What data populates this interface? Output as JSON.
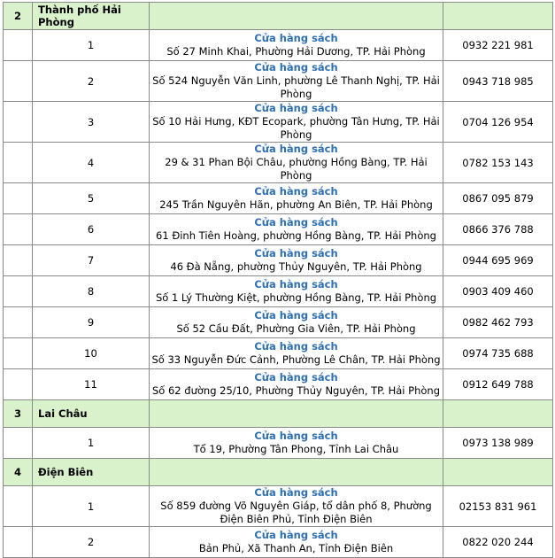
{
  "sections": [
    {
      "num": "2",
      "name": "Thành phố Hải Phòng",
      "rows": [
        {
          "idx": "1",
          "store": "Cửa hàng sách",
          "address": "Số 27 Minh Khai, Phường Hải Dương, TP. Hải Phòng",
          "phone": "0932 221 981"
        },
        {
          "idx": "2",
          "store": "Cửa hàng sách",
          "address": "Số 524 Nguyễn Văn Linh, phường Lê Thanh Nghị, TP. Hải Phòng",
          "phone": "0943 718 985"
        },
        {
          "idx": "3",
          "store": "Cửa hàng sách",
          "address": "Số 10 Hải Hưng, KĐT Ecopark, phường Tân Hưng, TP. Hải Phòng",
          "phone": "0704 126 954"
        },
        {
          "idx": "4",
          "store": "Cửa hàng sách",
          "address": "29 & 31 Phan Bội Châu, phường Hồng Bàng, TP. Hải Phòng",
          "phone": "0782 153 143"
        },
        {
          "idx": "5",
          "store": "Cửa hàng sách",
          "address": "245 Trần Nguyên Hãn, phường An Biên, TP. Hải Phòng",
          "phone": "0867 095 879"
        },
        {
          "idx": "6",
          "store": "Cửa hàng sách",
          "address": "61 Đinh Tiên Hoàng, phường Hồng Bàng, TP. Hải Phòng",
          "phone": "0866 376 788"
        },
        {
          "idx": "7",
          "store": "Cửa hàng sách",
          "address": "46 Đà Nẵng, phường Thủy Nguyên, TP. Hải Phòng",
          "phone": "0944 695 969"
        },
        {
          "idx": "8",
          "store": "Cửa hàng sách",
          "address": "Số 1 Lý Thường Kiệt, phường Hồng Bàng, TP. Hải Phòng",
          "phone": "0903 409 460"
        },
        {
          "idx": "9",
          "store": "Cửa hàng sách",
          "address": "Số 52 Cầu Đất, Phường Gia Viên, TP. Hải Phòng",
          "phone": "0982 462 793"
        },
        {
          "idx": "10",
          "store": "Cửa hàng sách",
          "address": "Số 33 Nguyễn Đức Cảnh, Phường Lê Chân, TP. Hải Phòng",
          "phone": "0974 735 688"
        },
        {
          "idx": "11",
          "store": "Cửa hàng sách",
          "address": "Số 62 đường 25/10, Phường Thủy Nguyên, TP. Hải Phòng",
          "phone": "0912 649 788"
        }
      ]
    },
    {
      "num": "3",
      "name": "Lai Châu",
      "rows": [
        {
          "idx": "1",
          "store": "Cửa hàng sách",
          "address": "Tổ 19, Phường Tân Phong, Tỉnh Lai Châu",
          "phone": "0973 138 989"
        }
      ]
    },
    {
      "num": "4",
      "name": "Điện Biên",
      "rows": [
        {
          "idx": "1",
          "store": "Cửa hàng sách",
          "address": "Số 859 đường Võ Nguyên Giáp, tổ dân phố 8, Phường Điện Biên Phủ, Tỉnh Điện Biên",
          "phone": "02153 831 961"
        },
        {
          "idx": "2",
          "store": "Cửa hàng sách",
          "address": "Bản Phủ, Xã Thanh An, Tỉnh Điện Biên",
          "phone": "0822 020 244"
        }
      ]
    }
  ],
  "colors": {
    "section_bg": "#d9f2cc",
    "store_name": "#2f6fb3",
    "border": "#8a8a8a"
  }
}
